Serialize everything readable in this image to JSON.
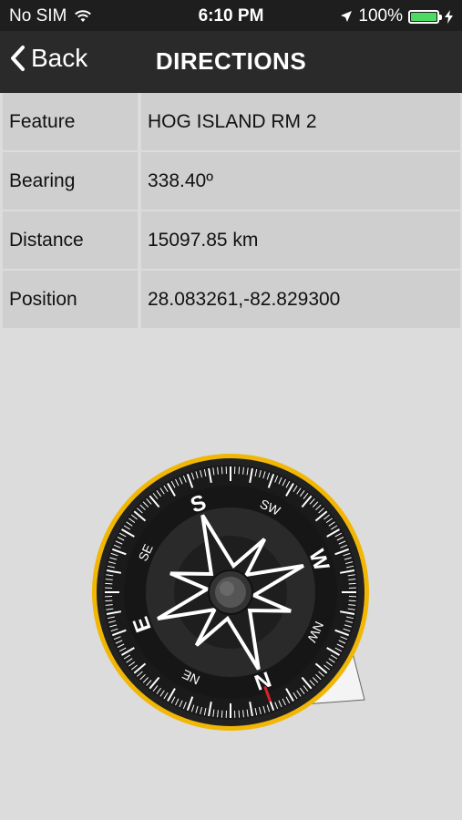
{
  "status": {
    "carrier": "No SIM",
    "time": "6:10 PM",
    "battery": "100%"
  },
  "nav": {
    "back_label": "Back",
    "title": "DIRECTIONS"
  },
  "rows": [
    {
      "key": "Feature",
      "value": "HOG ISLAND RM 2"
    },
    {
      "key": "Bearing",
      "value": "338.40º"
    },
    {
      "key": "Distance",
      "value": "15097.85 km"
    },
    {
      "key": "Position",
      "value": "28.083261,-82.829300"
    }
  ],
  "compass": {
    "cardinals": [
      "N",
      "E",
      "S",
      "W"
    ],
    "intercardinals": [
      "NE",
      "SE",
      "SW",
      "NW"
    ],
    "accent": "#f2b705"
  }
}
